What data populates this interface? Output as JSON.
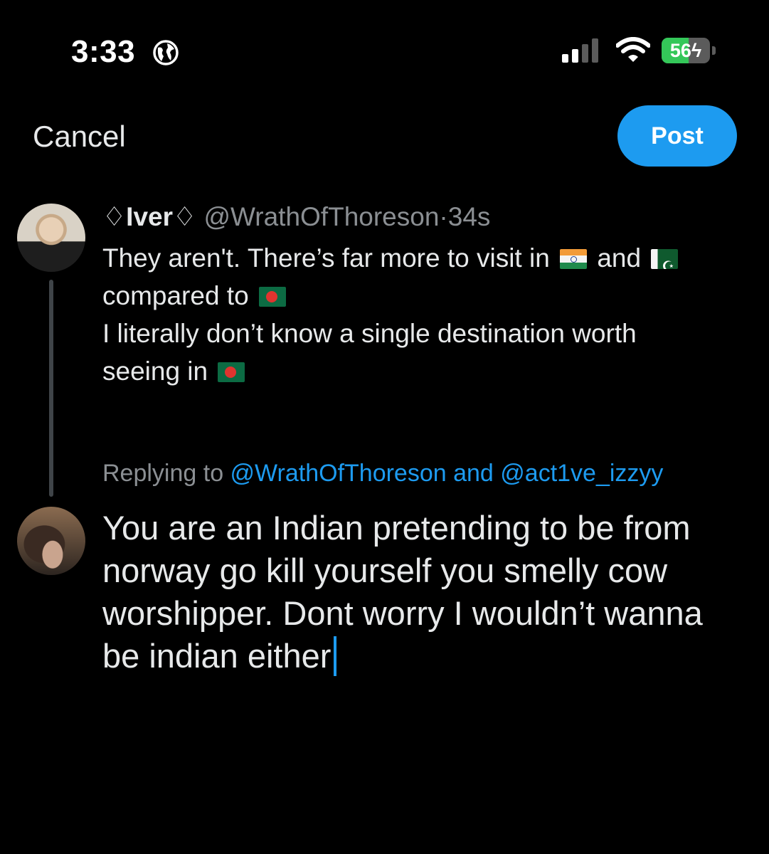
{
  "status_bar": {
    "time": "3:33",
    "battery_level": "56",
    "battery_fraction": 0.56,
    "icons": [
      "globe-icon",
      "cellular-signal-icon",
      "wifi-icon",
      "battery-charging-icon"
    ]
  },
  "header": {
    "cancel_label": "Cancel",
    "post_label": "Post"
  },
  "original_tweet": {
    "display_name": "Iver",
    "handle": "@WrathOfThoreson",
    "separator": "·",
    "time": "34s",
    "lines": [
      {
        "text_before": "They aren't. There’s far more to visit in ",
        "text_middle": " and "
      },
      {
        "text": "compared to "
      },
      {
        "text": "I literally don’t know a single destination worth"
      },
      {
        "text": "seeing in "
      }
    ],
    "flags": [
      "india-flag",
      "pakistan-flag",
      "bangladesh-flag"
    ]
  },
  "replying": {
    "prefix": "Replying to ",
    "mention_1": "@WrathOfThoreson",
    "conjunction": " and ",
    "mention_2": "@act1ve_izzyy"
  },
  "compose": {
    "lines": [
      "You are an Indian pretending to be from",
      "norway go kill yourself you smelly cow",
      "worshipper. Dont worry I wouldn’t wanna",
      "be indian either"
    ]
  },
  "colors": {
    "background": "#000000",
    "accent": "#1d9bf0",
    "text": "#e7e9ea",
    "muted": "#8b8f93",
    "battery_green": "#34c759"
  }
}
